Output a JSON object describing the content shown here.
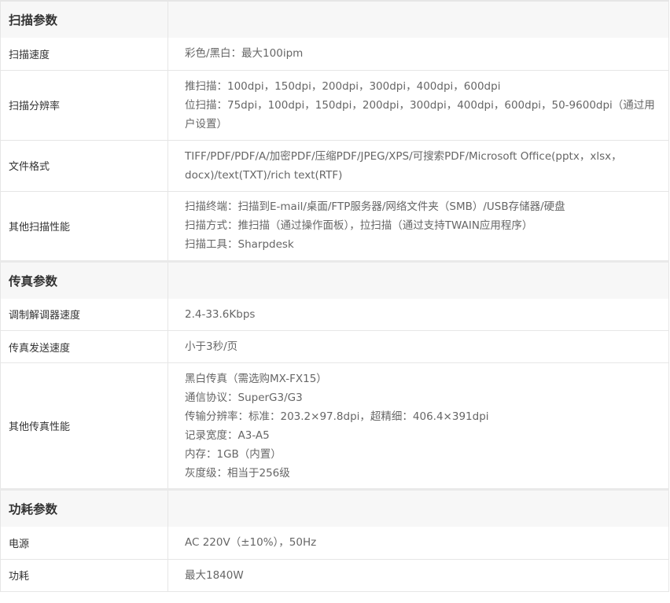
{
  "sections": [
    {
      "title": "扫描参数",
      "rows": [
        {
          "label": "扫描速度",
          "lines": [
            "彩色/黑白：最大100ipm"
          ]
        },
        {
          "label": "扫描分辨率",
          "lines": [
            "推扫描：100dpi，150dpi，200dpi，300dpi，400dpi，600dpi",
            "位扫描：75dpi，100dpi，150dpi，200dpi，300dpi，400dpi，600dpi，50-9600dpi（通过用户设置）"
          ]
        },
        {
          "label": "文件格式",
          "lines": [
            "TIFF/PDF/PDF/A/加密PDF/压缩PDF/JPEG/XPS/可搜索PDF/Microsoft Office(pptx，xlsx，docx)/text(TXT)/rich text(RTF)"
          ]
        },
        {
          "label": "其他扫描性能",
          "lines": [
            "扫描终端：扫描到E-mail/桌面/FTP服务器/网络文件夹（SMB）/USB存储器/硬盘",
            "扫描方式：推扫描（通过操作面板），拉扫描（通过支持TWAIN应用程序）",
            "扫描工具：Sharpdesk"
          ]
        }
      ]
    },
    {
      "title": "传真参数",
      "rows": [
        {
          "label": "调制解调器速度",
          "lines": [
            "2.4-33.6Kbps"
          ]
        },
        {
          "label": "传真发送速度",
          "lines": [
            "小于3秒/页"
          ]
        },
        {
          "label": "其他传真性能",
          "lines": [
            "黑白传真（需选购MX-FX15）",
            "通信协议：SuperG3/G3",
            "传输分辨率：标准：203.2×97.8dpi，超精细：406.4×391dpi",
            "记录宽度：A3-A5",
            "内存：1GB（内置）",
            "灰度级：相当于256级"
          ]
        }
      ]
    },
    {
      "title": "功耗参数",
      "rows": [
        {
          "label": "电源",
          "lines": [
            "AC 220V（±10%），50Hz"
          ]
        },
        {
          "label": "功耗",
          "lines": [
            "最大1840W"
          ]
        }
      ]
    }
  ]
}
